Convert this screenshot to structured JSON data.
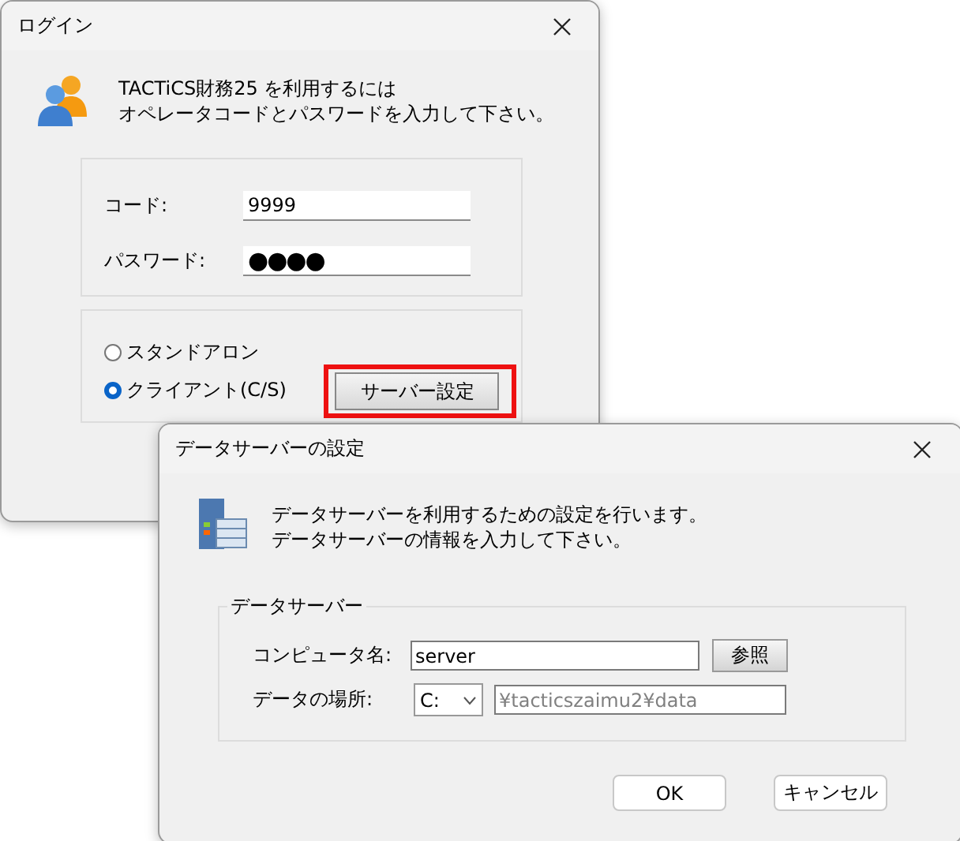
{
  "login_window": {
    "title": "ログイン",
    "message": [
      "TACTiCS財務25 を利用するには",
      "オペレータコードとパスワードを入力して下さい。"
    ],
    "fields": [
      {
        "kind": "text",
        "label": "コード:",
        "value": "9999"
      },
      {
        "kind": "password",
        "label": "パスワード:",
        "value": "●●●●"
      }
    ],
    "modes": [
      {
        "label": "スタンドアロン",
        "selected": false
      },
      {
        "label": "クライアント(C/S)",
        "selected": true
      }
    ],
    "server_button": {
      "label": "サーバー設定",
      "highlighted": true
    }
  },
  "server_dialog": {
    "title": "データサーバーの設定",
    "message": [
      "データサーバーを利用するための設定を行います。",
      "データサーバーの情報を入力して下さい。"
    ],
    "group_title": "データサーバー",
    "computer_name": {
      "label": "コンピュータ名:",
      "value": "server"
    },
    "browse_button": "参照",
    "data_location": {
      "label": "データの場所:",
      "drive": "C:",
      "path": "¥tacticszaimu2¥data",
      "disabled": true
    },
    "buttons": [
      "OK",
      "キャンセル"
    ]
  }
}
